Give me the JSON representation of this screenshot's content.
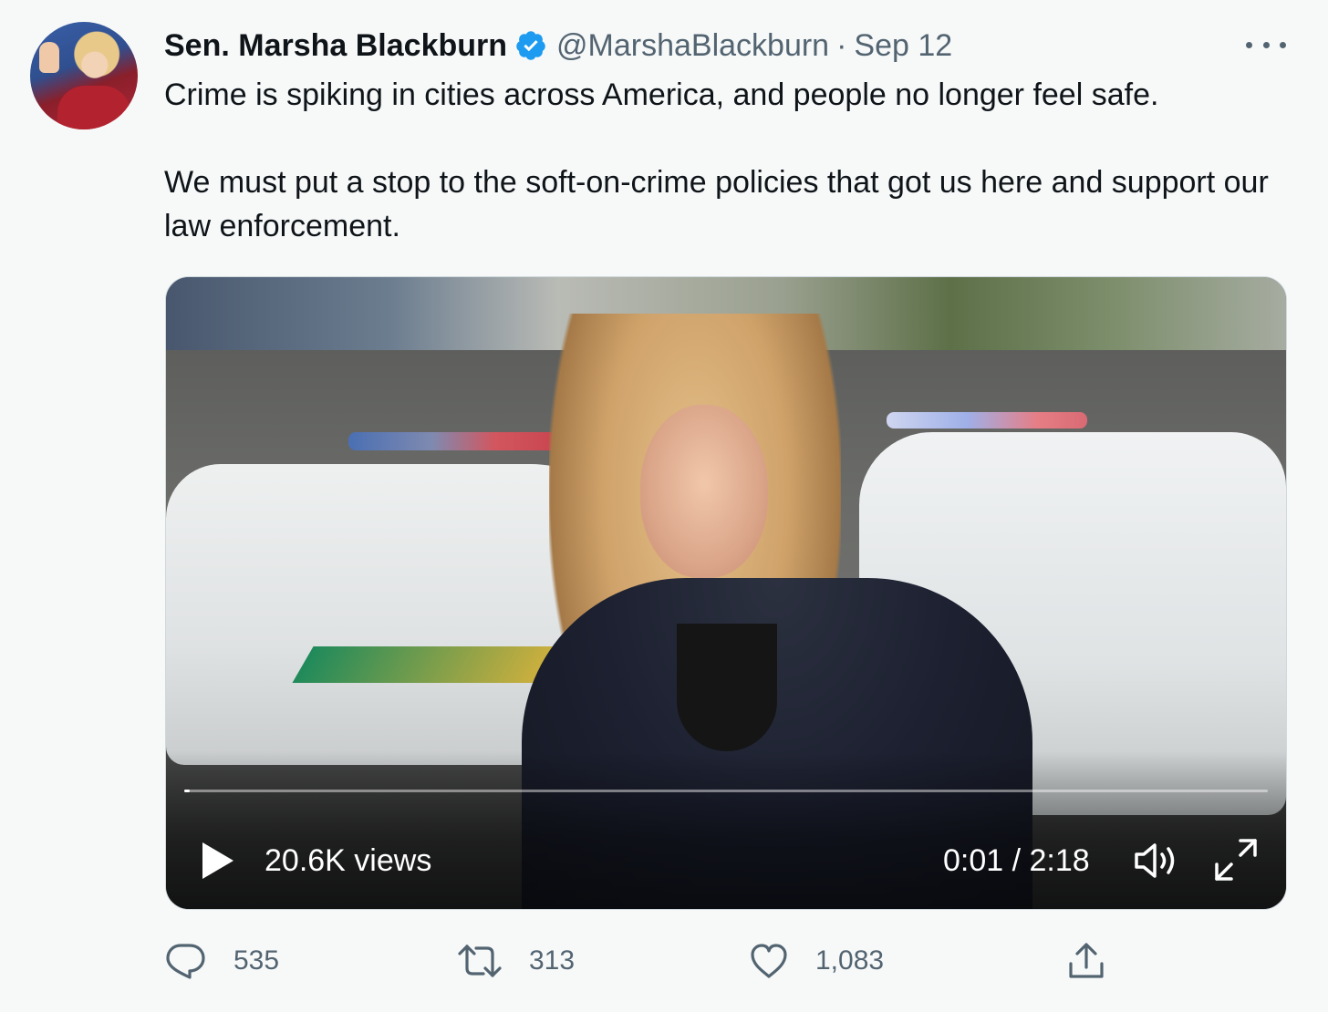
{
  "tweet": {
    "author_name": "Sen. Marsha Blackburn",
    "verified_icon": "verified-badge-icon",
    "handle": "@MarshaBlackburn",
    "separator": "·",
    "date": "Sep 12",
    "text": "Crime is spiking in cities across America, and people no longer feel safe.\n\nWe must put a stop to the soft-on-crime policies that got us here and support our law enforcement."
  },
  "video": {
    "views": "20.6K views",
    "time": "0:01 / 2:18",
    "progress_fraction": 0.004
  },
  "actions": {
    "reply_count": "535",
    "retweet_count": "313",
    "like_count": "1,083"
  },
  "colors": {
    "background": "#f7f9f9",
    "text_primary": "#0f1419",
    "text_secondary": "#536471",
    "verified_blue": "#1d9bf0"
  }
}
